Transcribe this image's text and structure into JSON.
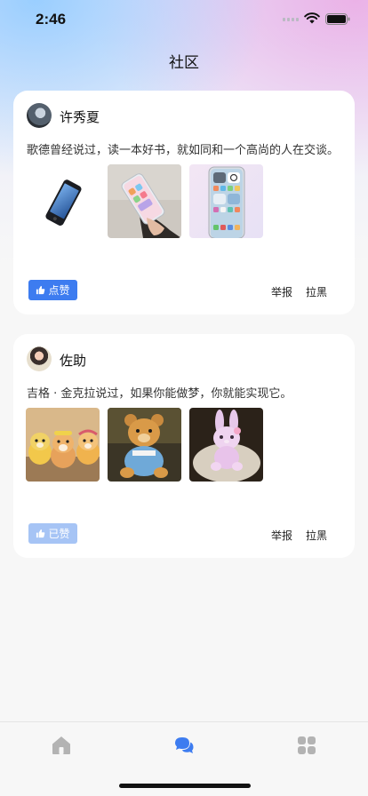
{
  "status_bar": {
    "time": "2:46"
  },
  "header": {
    "title": "社区"
  },
  "posts": [
    {
      "username": "许秀夏",
      "text": "歌德曾经说过，读一本好书，就如同和一个高尚的人在交谈。",
      "images": [
        "phone-image",
        "phone-in-hand-image",
        "phone-screen-image"
      ],
      "like_label": "点赞",
      "report_label": "举报",
      "block_label": "拉黑"
    },
    {
      "username": "佐助",
      "text": "吉格 · 金克拉说过，如果你能做梦，你就能实现它。",
      "images": [
        "plush-dogs-image",
        "teddy-bear-image",
        "bunny-plush-image"
      ],
      "like_label": "已赞",
      "report_label": "举报",
      "block_label": "拉黑"
    }
  ],
  "tabbar": {
    "items": [
      {
        "icon": "home-icon"
      },
      {
        "icon": "chat-bubbles-icon"
      },
      {
        "icon": "grid-apps-icon"
      }
    ]
  },
  "colors": {
    "accent": "#3d7cf0",
    "accent_light": "#a6c4f5",
    "tab_inactive": "#b3b3b3"
  }
}
